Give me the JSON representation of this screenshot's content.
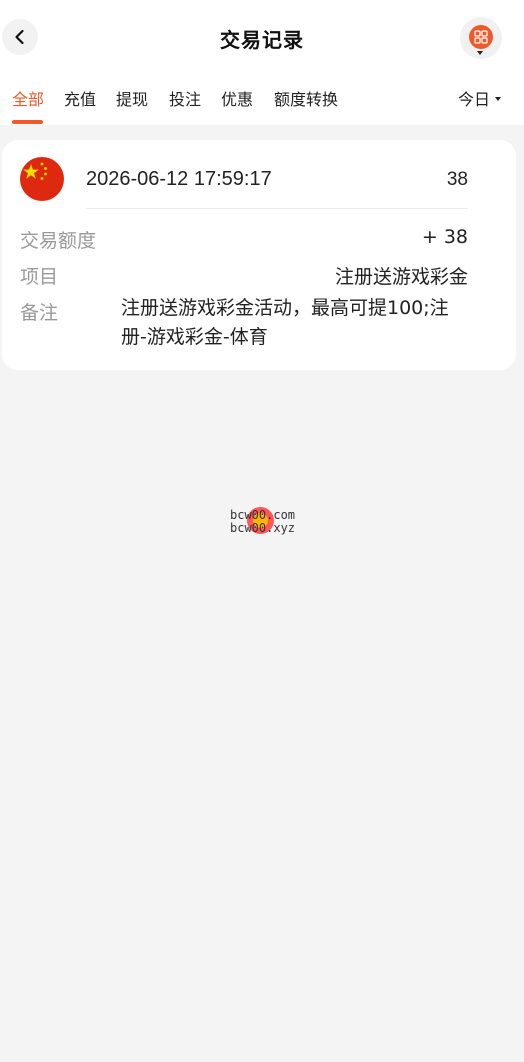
{
  "header": {
    "title": "交易记录",
    "back_icon": "chevron-left-icon",
    "menu_icon": "grid-menu-icon",
    "accent_color": "#f0592a"
  },
  "tabs": [
    {
      "label": "全部",
      "active": true
    },
    {
      "label": "充值",
      "active": false
    },
    {
      "label": "提现",
      "active": false
    },
    {
      "label": "投注",
      "active": false
    },
    {
      "label": "优惠",
      "active": false
    },
    {
      "label": "额度转换",
      "active": false
    }
  ],
  "date_filter": {
    "label": "今日",
    "icon": "caret-down-icon"
  },
  "record": {
    "flag_icon": "china-flag-icon",
    "datetime": "2026-06-12 17:59:17",
    "amount_top": "38",
    "amount_label": "交易额度",
    "amount_value": "+ 38",
    "item_label": "项目",
    "item_value": "注册送游戏彩金",
    "remark_label": "备注",
    "remark_value": "注册送游戏彩金活动，最高可提100;注册-游戏彩金-体育"
  },
  "watermark": {
    "line1": "bcw00.com",
    "line2": "bcw00.xyz"
  }
}
